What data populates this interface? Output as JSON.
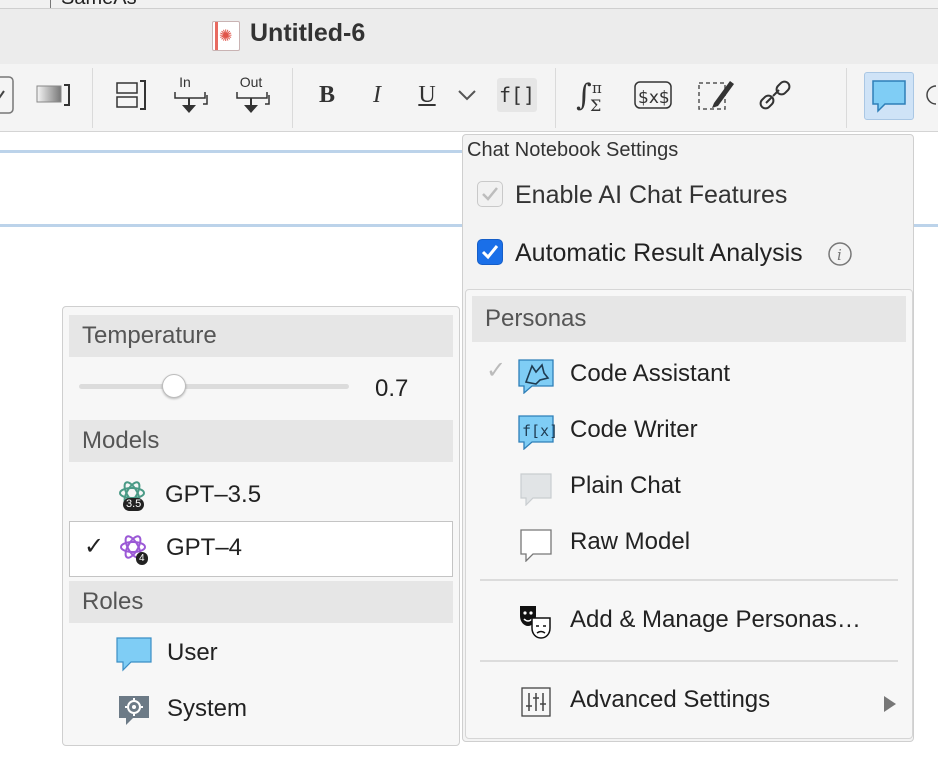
{
  "window": {
    "partial_tab_text": "SameAs",
    "title": "Untitled-6"
  },
  "toolbar": {
    "input_label_top": "In",
    "output_label_top": "Out",
    "bold": "B",
    "italic": "I",
    "underline": "U",
    "function_template": "f[]"
  },
  "settings_menu": {
    "header": "Chat Notebook Settings",
    "enable_ai_chat_features": {
      "label": "Enable AI Chat Features",
      "checked": true,
      "disabled": true
    },
    "automatic_result_analysis": {
      "label": "Automatic Result Analysis",
      "checked": true
    },
    "personas_header": "Personas",
    "personas": [
      {
        "label": "Code Assistant",
        "selected": true,
        "icon": "wolf-chat-icon"
      },
      {
        "label": "Code Writer",
        "selected": false,
        "icon": "fx-chat-icon"
      },
      {
        "label": "Plain Chat",
        "selected": false,
        "icon": "gray-chat-bubble-icon"
      },
      {
        "label": "Raw Model",
        "selected": false,
        "icon": "outline-chat-bubble-icon"
      }
    ],
    "manage_personas": "Add & Manage Personas…",
    "advanced_settings": "Advanced Settings"
  },
  "model_menu": {
    "temperature_header": "Temperature",
    "temperature_value": "0.7",
    "temperature_fraction": 0.35,
    "models_header": "Models",
    "models": [
      {
        "label": "GPT–3.5",
        "badge": "3.5",
        "selected": false
      },
      {
        "label": "GPT–4",
        "badge": "4",
        "selected": true
      }
    ],
    "roles_header": "Roles",
    "roles": [
      {
        "label": "User",
        "icon": "blue-chat-bubble-icon"
      },
      {
        "label": "System",
        "icon": "gear-chat-icon"
      }
    ]
  },
  "colors": {
    "accent": "#1a6fe8",
    "chat_blue": "#7fcdf5",
    "openai_green": "#4a9a86",
    "openai_purple": "#9b59d6"
  }
}
